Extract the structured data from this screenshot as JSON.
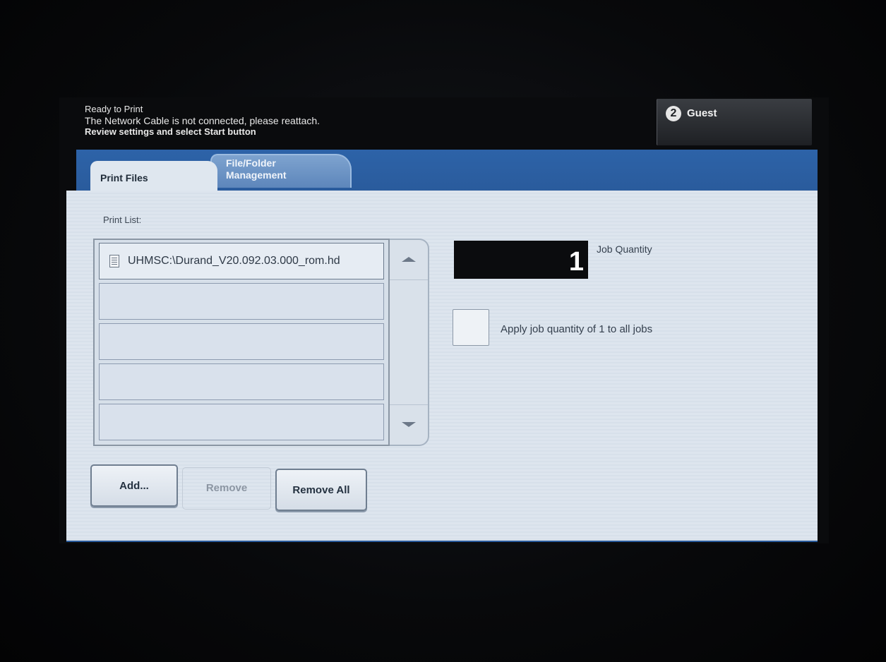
{
  "status": {
    "line1": "Ready to Print",
    "line2": "The Network Cable is not connected, please reattach.",
    "line3": "Review settings and select Start button"
  },
  "user": {
    "icon_glyph": "2",
    "label": "Guest"
  },
  "tabs": [
    {
      "label": "Print Files",
      "active": true
    },
    {
      "label_line1": "File/Folder",
      "label_line2": "Management",
      "active": false
    }
  ],
  "print_list": {
    "label": "Print List:",
    "items": [
      "UHMSC:\\Durand_V20.092.03.000_rom.hd",
      "",
      "",
      "",
      ""
    ]
  },
  "buttons": {
    "add": "Add...",
    "remove": "Remove",
    "remove_all": "Remove All"
  },
  "job_quantity": {
    "value": "1",
    "label": "Job Quantity"
  },
  "apply_all": {
    "label": "Apply job quantity of 1 to all jobs",
    "checked": false
  },
  "colors": {
    "tab_bar": "#2d63a8",
    "panel": "#dde5ee",
    "quantity_display": "#0b0c0e"
  }
}
